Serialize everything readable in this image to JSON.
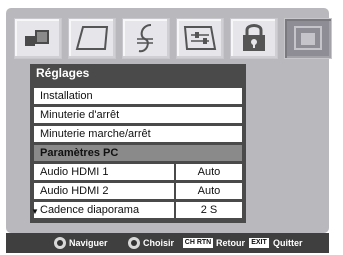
{
  "icons": [
    "picture-icon",
    "sound-icon",
    "music-note-icon",
    "settings-sliders-icon",
    "lock-icon",
    "setup-active-icon"
  ],
  "menu": {
    "title": "Réglages",
    "items": [
      {
        "label": "Installation",
        "value": ""
      },
      {
        "label": "Minuterie d'arrêt",
        "value": ""
      },
      {
        "label": "Minuterie marche/arrêt",
        "value": ""
      },
      {
        "label": "Paramètres PC",
        "value": ""
      },
      {
        "label": "Audio HDMI 1",
        "value": "Auto"
      },
      {
        "label": "Audio HDMI 2",
        "value": "Auto"
      },
      {
        "label": "Cadence diaporama",
        "value": "2 S"
      }
    ]
  },
  "footer": {
    "navigate": "Naviguer",
    "choose": "Choisir",
    "ch_rtn_key": "CH RTN",
    "back": "Retour",
    "exit_key": "EXIT",
    "quit": "Quitter"
  },
  "colors": {
    "frame": "#b9b8bd",
    "menu_bg": "#4a4a4a",
    "highlight": "#8a8a8a",
    "footer_bg": "#3f3f3f"
  }
}
